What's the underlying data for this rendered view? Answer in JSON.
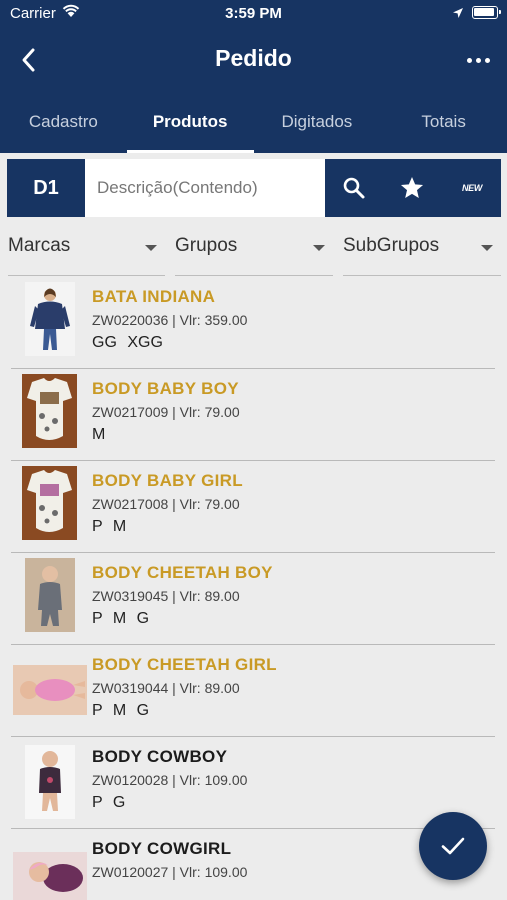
{
  "status": {
    "carrier": "Carrier",
    "time": "3:59 PM"
  },
  "header": {
    "title": "Pedido"
  },
  "tabs": [
    {
      "label": "Cadastro",
      "active": false
    },
    {
      "label": "Produtos",
      "active": true
    },
    {
      "label": "Digitados",
      "active": false
    },
    {
      "label": "Totais",
      "active": false
    }
  ],
  "search": {
    "table_label": "D1",
    "placeholder": "Descrição(Contendo)",
    "new_label": "NEW"
  },
  "filters": {
    "brands": "Marcas",
    "groups": "Grupos",
    "subgroups": "SubGrupos"
  },
  "products": [
    {
      "name": "BATA INDIANA",
      "code": "ZW0220036  | Vlr: 359.00",
      "sizes": "GG XGG",
      "highlight": true,
      "thumb": "jacket-photo"
    },
    {
      "name": "BODY BABY BOY",
      "code": "ZW0217009  | Vlr: 79.00",
      "sizes": "M",
      "highlight": true,
      "thumb": "onesie-photo"
    },
    {
      "name": "BODY BABY GIRL",
      "code": "ZW0217008  | Vlr: 79.00",
      "sizes": "P M",
      "highlight": true,
      "thumb": "onesie-photo"
    },
    {
      "name": "BODY CHEETAH BOY",
      "code": "ZW0319045  | Vlr: 89.00",
      "sizes": "P M G",
      "highlight": true,
      "thumb": "baby-photo"
    },
    {
      "name": "BODY CHEETAH GIRL",
      "code": "ZW0319044  | Vlr: 89.00",
      "sizes": "P M G",
      "highlight": true,
      "thumb": "baby-photo"
    },
    {
      "name": "BODY COWBOY",
      "code": "ZW0120028  | Vlr: 109.00",
      "sizes": "P G",
      "highlight": false,
      "thumb": "baby-photo"
    },
    {
      "name": "BODY COWGIRL",
      "code": "ZW0120027  | Vlr: 109.00",
      "sizes": "",
      "highlight": false,
      "thumb": "baby-photo"
    }
  ],
  "colors": {
    "primary": "#173462",
    "highlight": "#c99a25",
    "background": "#ececec"
  },
  "icons": [
    "wifi-icon",
    "location-arrow-icon",
    "battery-icon",
    "back-chevron-icon",
    "more-icon",
    "search-icon",
    "star-icon",
    "new-badge-icon",
    "checkmark-icon"
  ]
}
